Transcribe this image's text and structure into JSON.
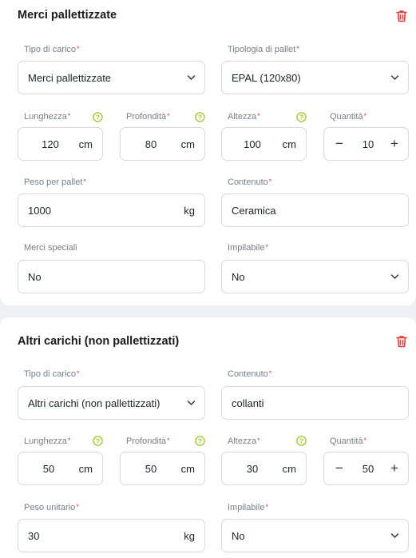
{
  "card1": {
    "title": "Merci pallettizzate",
    "delete_icon": "trash-icon",
    "load_type": {
      "label": "Tipo di carico",
      "value": "Merci pallettizzate"
    },
    "pallet_type": {
      "label": "Tipologia di pallet",
      "value": "EPAL (120x80)"
    },
    "length": {
      "label": "Lunghezza",
      "value": "120",
      "unit": "cm"
    },
    "depth": {
      "label": "Profondità",
      "value": "80",
      "unit": "cm"
    },
    "height": {
      "label": "Altezza",
      "value": "100",
      "unit": "cm"
    },
    "quantity": {
      "label": "Quantità",
      "value": "10",
      "minus": "−",
      "plus": "+"
    },
    "weight": {
      "label": "Peso per pallet",
      "value": "1000",
      "unit": "kg"
    },
    "content": {
      "label": "Contenuto",
      "value": "Ceramica"
    },
    "special": {
      "label": "Merci speciali",
      "value": "No"
    },
    "stackable": {
      "label": "Impilabile",
      "value": "No"
    }
  },
  "card2": {
    "title": "Altri carichi (non pallettizzati)",
    "delete_icon": "trash-icon",
    "load_type": {
      "label": "Tipo di carico",
      "value": "Altri carichi (non pallettizzati)"
    },
    "content": {
      "label": "Contenuto",
      "value": "collanti"
    },
    "length": {
      "label": "Lunghezza",
      "value": "50",
      "unit": "cm"
    },
    "depth": {
      "label": "Profondità",
      "value": "50",
      "unit": "cm"
    },
    "height": {
      "label": "Altezza",
      "value": "30",
      "unit": "cm"
    },
    "quantity": {
      "label": "Quantità",
      "value": "50",
      "minus": "−",
      "plus": "+"
    },
    "weight": {
      "label": "Peso unitario",
      "value": "30",
      "unit": "kg"
    },
    "stackable": {
      "label": "Impilabile",
      "value": "No"
    }
  },
  "colors": {
    "accent_red": "#e23c3c",
    "help_green": "#9bc91a",
    "border": "#d6d9de"
  }
}
